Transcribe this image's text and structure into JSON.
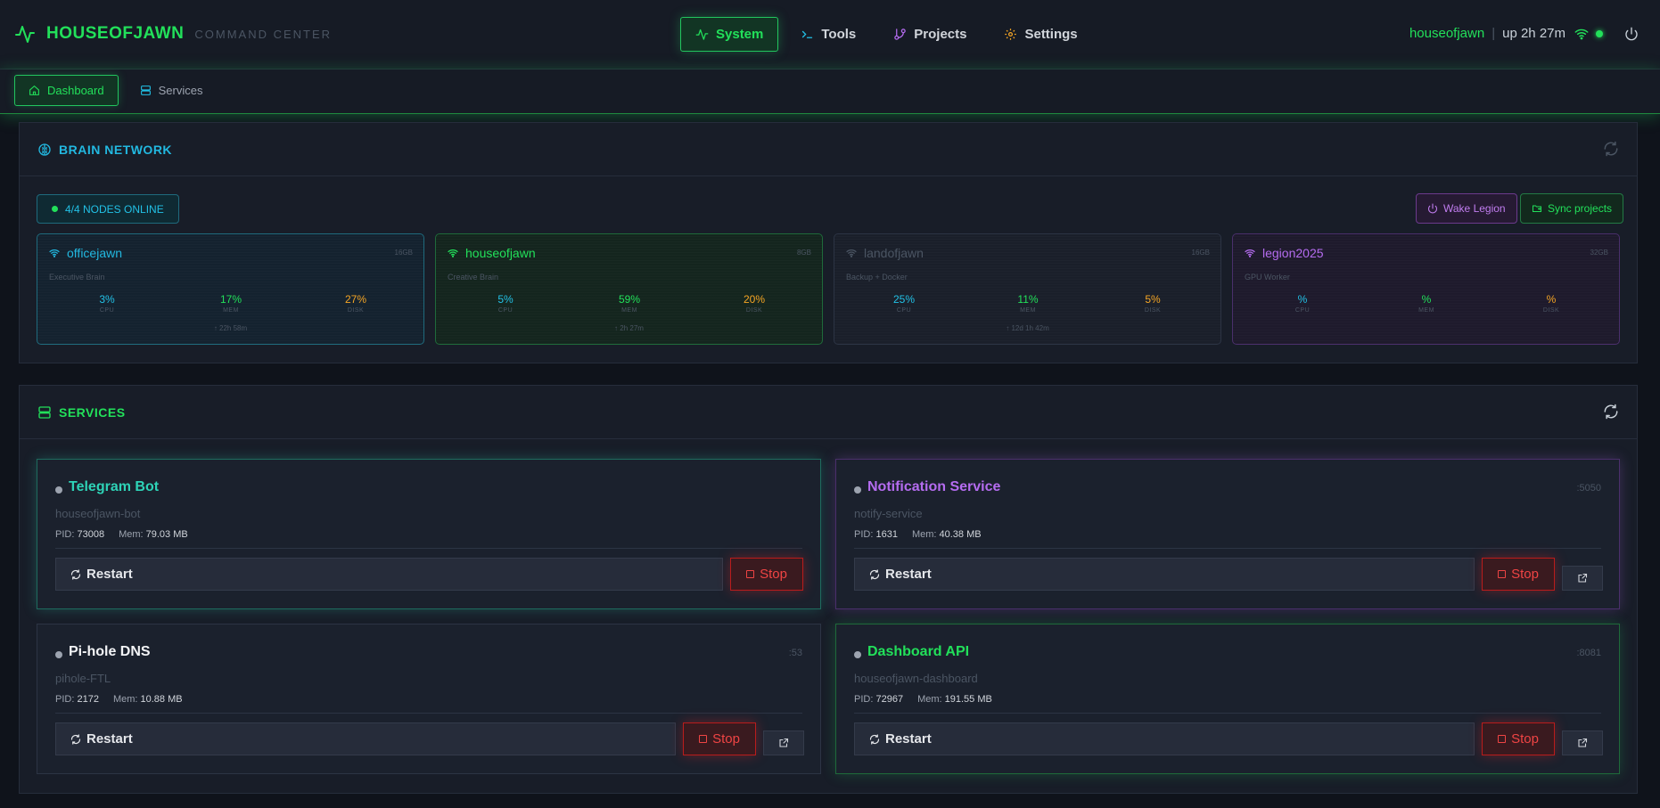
{
  "brand": {
    "name": "HOUSEOFJAWN",
    "subtitle": "COMMAND CENTER"
  },
  "nav": {
    "items": [
      {
        "label": "System",
        "icon": "activity-icon",
        "active": true
      },
      {
        "label": "Tools",
        "icon": "terminal-icon"
      },
      {
        "label": "Projects",
        "icon": "git-branch-icon"
      },
      {
        "label": "Settings",
        "icon": "gear-icon"
      }
    ]
  },
  "user": {
    "name": "houseofjawn",
    "separator": "|",
    "uptime": "up 2h 27m"
  },
  "subnav": {
    "items": [
      {
        "label": "Dashboard",
        "active": true
      },
      {
        "label": "Services"
      }
    ]
  },
  "brain": {
    "title": "BRAIN NETWORK",
    "status": "4/4 NODES ONLINE",
    "wake_label": "Wake Legion",
    "sync_label": "Sync projects",
    "nodes": [
      {
        "name": "officejawn",
        "ram": "16GB",
        "role": "Executive Brain",
        "cpu": "3%",
        "mem": "17%",
        "disk": "27%",
        "uptime": "↑ 22h 58m",
        "color": "#22b8e0"
      },
      {
        "name": "houseofjawn",
        "ram": "8GB",
        "role": "Creative Brain",
        "cpu": "5%",
        "mem": "59%",
        "disk": "20%",
        "uptime": "↑ 2h 27m",
        "color": "#22e05a"
      },
      {
        "name": "landofjawn",
        "ram": "16GB",
        "role": "Backup + Docker",
        "cpu": "25%",
        "mem": "11%",
        "disk": "5%",
        "uptime": "↑ 12d 1h 42m",
        "color": "#4b5563"
      },
      {
        "name": "legion2025",
        "ram": "32GB",
        "role": "GPU Worker",
        "cpu": "%",
        "mem": "%",
        "disk": "%",
        "uptime": "",
        "color": "#b56cf0"
      }
    ],
    "labels": {
      "cpu": "CPU",
      "mem": "MEM",
      "disk": "DISK"
    }
  },
  "services": {
    "title": "SERVICES",
    "restart_label": "Restart",
    "stop_label": "Stop",
    "pid_label": "PID:",
    "mem_label": "Mem:",
    "items": [
      {
        "name": "Telegram Bot",
        "port": "",
        "process": "houseofjawn-bot",
        "pid": "73008",
        "mem": "79.03 MB",
        "color": "#2ed3b7"
      },
      {
        "name": "Notification Service",
        "port": ":5050",
        "process": "notify-service",
        "pid": "1631",
        "mem": "40.38 MB",
        "color": "#b56cf0"
      },
      {
        "name": "Pi-hole DNS",
        "port": ":53",
        "process": "pihole-FTL",
        "pid": "2172",
        "mem": "10.88 MB",
        "color": "#f3f4f6"
      },
      {
        "name": "Dashboard API",
        "port": ":8081",
        "process": "houseofjawn-dashboard",
        "pid": "72967",
        "mem": "191.55 MB",
        "color": "#22e05a"
      }
    ]
  }
}
